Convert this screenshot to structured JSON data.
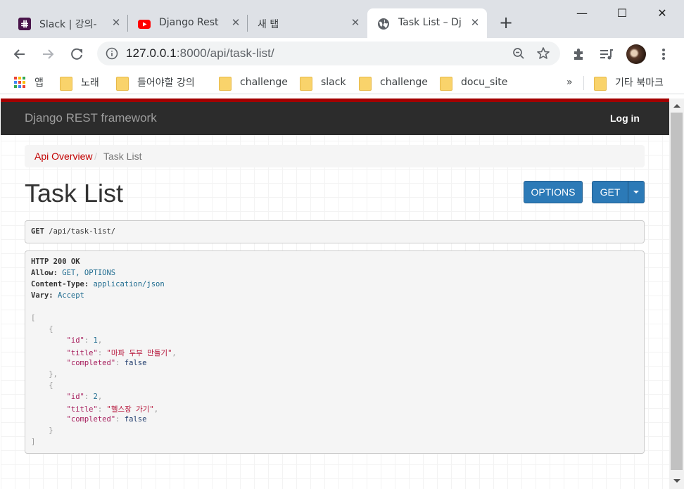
{
  "browser": {
    "tabs": [
      {
        "title": "Slack | 강의-",
        "icon": "slack-icon",
        "active": false
      },
      {
        "title": "Django Rest",
        "icon": "youtube-icon",
        "active": false
      },
      {
        "title": "새 탭",
        "icon": "none",
        "active": false
      },
      {
        "title": "Task List – Dj",
        "icon": "globe-icon",
        "active": true
      }
    ],
    "new_tab_label": "+",
    "window_controls": {
      "minimize": "—",
      "maximize": "☐",
      "close": "✕"
    },
    "address": {
      "host": "127.0.0.1",
      "rest": ":8000/api/task-list/"
    },
    "bookmarks": [
      {
        "label": "앱",
        "type": "apps"
      },
      {
        "label": "노래",
        "type": "folder"
      },
      {
        "label": "들어야할 강의",
        "type": "folder"
      },
      {
        "label": "challenge",
        "type": "folder"
      },
      {
        "label": "slack",
        "type": "folder"
      },
      {
        "label": "challenge",
        "type": "folder"
      },
      {
        "label": "docu_site",
        "type": "folder"
      }
    ],
    "bookmarks_overflow": "»",
    "other_bookmarks": "기타 북마크"
  },
  "page": {
    "brand": "Django REST framework",
    "login": "Log in",
    "breadcrumb": {
      "link": "Api Overview",
      "separator": "/",
      "active": "Task List"
    },
    "title": "Task List",
    "buttons": {
      "options": "OPTIONS",
      "get": "GET"
    },
    "request": {
      "method": "GET",
      "path": "/api/task-list/"
    },
    "response": {
      "status": "HTTP 200 OK",
      "headers": [
        {
          "name": "Allow:",
          "value": "GET, OPTIONS"
        },
        {
          "name": "Content-Type:",
          "value": "application/json"
        },
        {
          "name": "Vary:",
          "value": "Accept"
        }
      ],
      "items": [
        {
          "id": "1",
          "title": "\"마파 두부 만들기\"",
          "completed": "false"
        },
        {
          "id": "2",
          "title": "\"헬스장 가기\"",
          "completed": "false"
        }
      ],
      "keys": {
        "id": "\"id\"",
        "title": "\"title\"",
        "completed": "\"completed\""
      }
    }
  },
  "colors": {
    "accent": "#2c7ab7",
    "redbar": "#a30000",
    "navbar": "#2c2c2c",
    "link": "#c20000"
  }
}
